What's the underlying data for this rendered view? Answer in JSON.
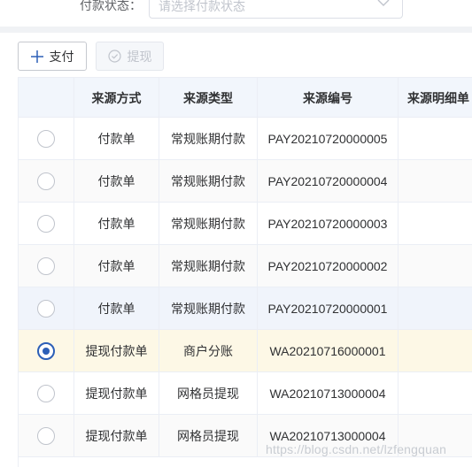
{
  "filter": {
    "label": "付款状态：",
    "placeholder": "请选择付款状态",
    "chevron_icon": "chevron-down-icon"
  },
  "toolbar": {
    "pay_label": "支付",
    "pay_icon": "plus-icon",
    "withdraw_label": "提现",
    "withdraw_icon": "check-circle-icon"
  },
  "table": {
    "columns": [
      "",
      "来源方式",
      "来源类型",
      "来源编号",
      "来源明细单"
    ],
    "rows": [
      {
        "selected": false,
        "method": "付款单",
        "type": "常规账期付款",
        "number": "PAY20210720000005",
        "detail": ""
      },
      {
        "selected": false,
        "method": "付款单",
        "type": "常规账期付款",
        "number": "PAY20210720000004",
        "detail": ""
      },
      {
        "selected": false,
        "method": "付款单",
        "type": "常规账期付款",
        "number": "PAY20210720000003",
        "detail": ""
      },
      {
        "selected": false,
        "method": "付款单",
        "type": "常规账期付款",
        "number": "PAY20210720000002",
        "detail": ""
      },
      {
        "selected": false,
        "method": "付款单",
        "type": "常规账期付款",
        "number": "PAY20210720000001",
        "detail": ""
      },
      {
        "selected": true,
        "method": "提现付款单",
        "type": "商户分账",
        "number": "WA20210716000001",
        "detail": ""
      },
      {
        "selected": false,
        "method": "提现付款单",
        "type": "网格员提现",
        "number": "WA20210713000004",
        "detail": ""
      },
      {
        "selected": false,
        "method": "提现付款单",
        "type": "网格员提现",
        "number": "WA20210713000004",
        "detail": ""
      }
    ]
  },
  "colors": {
    "header_bg": "#f2f6fc",
    "row_alt_bg": "#fafafa",
    "row_hover_bg": "#f0f4fb",
    "row_selected_bg": "#fdf8e6",
    "radio_checked": "#2c5fb7"
  },
  "watermark": "https://blog.csdn.net/lzfengquan"
}
